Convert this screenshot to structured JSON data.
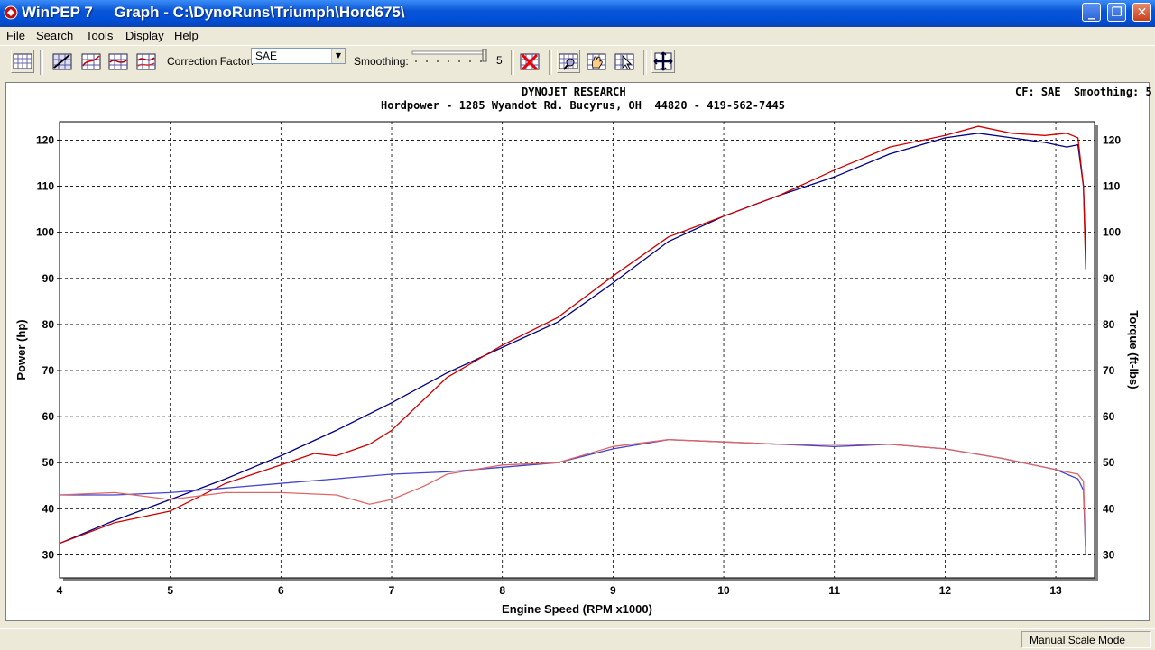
{
  "window": {
    "title": "WinPEP 7     Graph - C:\\DynoRuns\\Triumph\\Hord675\\"
  },
  "menu": [
    "File",
    "Search",
    "Tools",
    "Display",
    "Help"
  ],
  "toolbar": {
    "correction_label": "Correction Factor:",
    "correction_value": "SAE",
    "smoothing_label": "Smoothing:",
    "smoothing_value": "5"
  },
  "graph": {
    "header_line1": "DYNOJET RESEARCH",
    "header_line2": "Hordpower - 1285 Wyandot Rd. Bucyrus, OH  44820 - 419-562-7445",
    "header_right": "CF: SAE  Smoothing: 5"
  },
  "status": {
    "mode": "Manual Scale Mode"
  },
  "chart_data": {
    "type": "line",
    "xlabel": "Engine Speed (RPM x1000)",
    "ylabel": "Power (hp)",
    "y2label": "Torque (ft-lbs)",
    "xlim": [
      4,
      13.35
    ],
    "ylim": [
      25,
      124
    ],
    "x_ticks": [
      4,
      5,
      6,
      7,
      8,
      9,
      10,
      11,
      12,
      13
    ],
    "y_ticks": [
      30,
      40,
      50,
      60,
      70,
      80,
      90,
      100,
      110,
      120
    ],
    "grid": true,
    "series": [
      {
        "color": "#000080",
        "kind": "power",
        "x": [
          4.0,
          4.5,
          5.0,
          5.5,
          6.0,
          6.5,
          7.0,
          7.5,
          8.0,
          8.5,
          9.0,
          9.5,
          10.0,
          10.5,
          11.0,
          11.5,
          12.0,
          12.3,
          12.6,
          12.9,
          13.1,
          13.2,
          13.25,
          13.27
        ],
        "y": [
          32.5,
          37.5,
          42,
          46.5,
          51.5,
          57,
          63,
          69.5,
          75,
          80.5,
          89,
          98,
          103.5,
          108,
          112,
          117,
          120.5,
          121.5,
          120.5,
          119.5,
          118.5,
          119,
          110,
          95
        ]
      },
      {
        "color": "#cc0000",
        "kind": "power",
        "x": [
          4.0,
          4.5,
          5.0,
          5.5,
          6.0,
          6.3,
          6.5,
          6.8,
          7.0,
          7.5,
          8.0,
          8.5,
          9.0,
          9.5,
          10.0,
          10.5,
          11.0,
          11.5,
          12.0,
          12.3,
          12.6,
          12.9,
          13.1,
          13.2,
          13.25,
          13.27
        ],
        "y": [
          32.5,
          37,
          39.5,
          45.5,
          49.5,
          52,
          51.5,
          54,
          57,
          68.5,
          75.5,
          81.5,
          90.5,
          99,
          103.5,
          108,
          113.5,
          118.5,
          121,
          123,
          121.5,
          121,
          121.5,
          120.5,
          110,
          92
        ]
      },
      {
        "color": "#4444cc",
        "kind": "torque",
        "x": [
          4.0,
          4.5,
          5.0,
          5.5,
          6.0,
          6.5,
          7.0,
          7.5,
          8.0,
          8.5,
          9.0,
          9.5,
          10.0,
          10.5,
          11.0,
          11.5,
          12.0,
          12.5,
          13.0,
          13.2,
          13.25,
          13.27
        ],
        "y": [
          43,
          43,
          43.5,
          44.5,
          45.5,
          46.5,
          47.5,
          48,
          49,
          50,
          53,
          55,
          54.5,
          54,
          53.5,
          54,
          53,
          51,
          48.5,
          46.5,
          44,
          30
        ]
      },
      {
        "color": "#dd6666",
        "kind": "torque",
        "x": [
          4.0,
          4.5,
          5.0,
          5.5,
          6.0,
          6.5,
          6.8,
          7.0,
          7.3,
          7.5,
          8.0,
          8.5,
          9.0,
          9.5,
          10.0,
          10.5,
          11.0,
          11.5,
          12.0,
          12.5,
          13.0,
          13.2,
          13.25,
          13.27
        ],
        "y": [
          43,
          43.5,
          42,
          43.5,
          43.5,
          43,
          41,
          42,
          45,
          47.5,
          49.5,
          50,
          53.5,
          55,
          54.5,
          54,
          54,
          54,
          53,
          51,
          48.5,
          47.5,
          46,
          31
        ]
      }
    ]
  }
}
